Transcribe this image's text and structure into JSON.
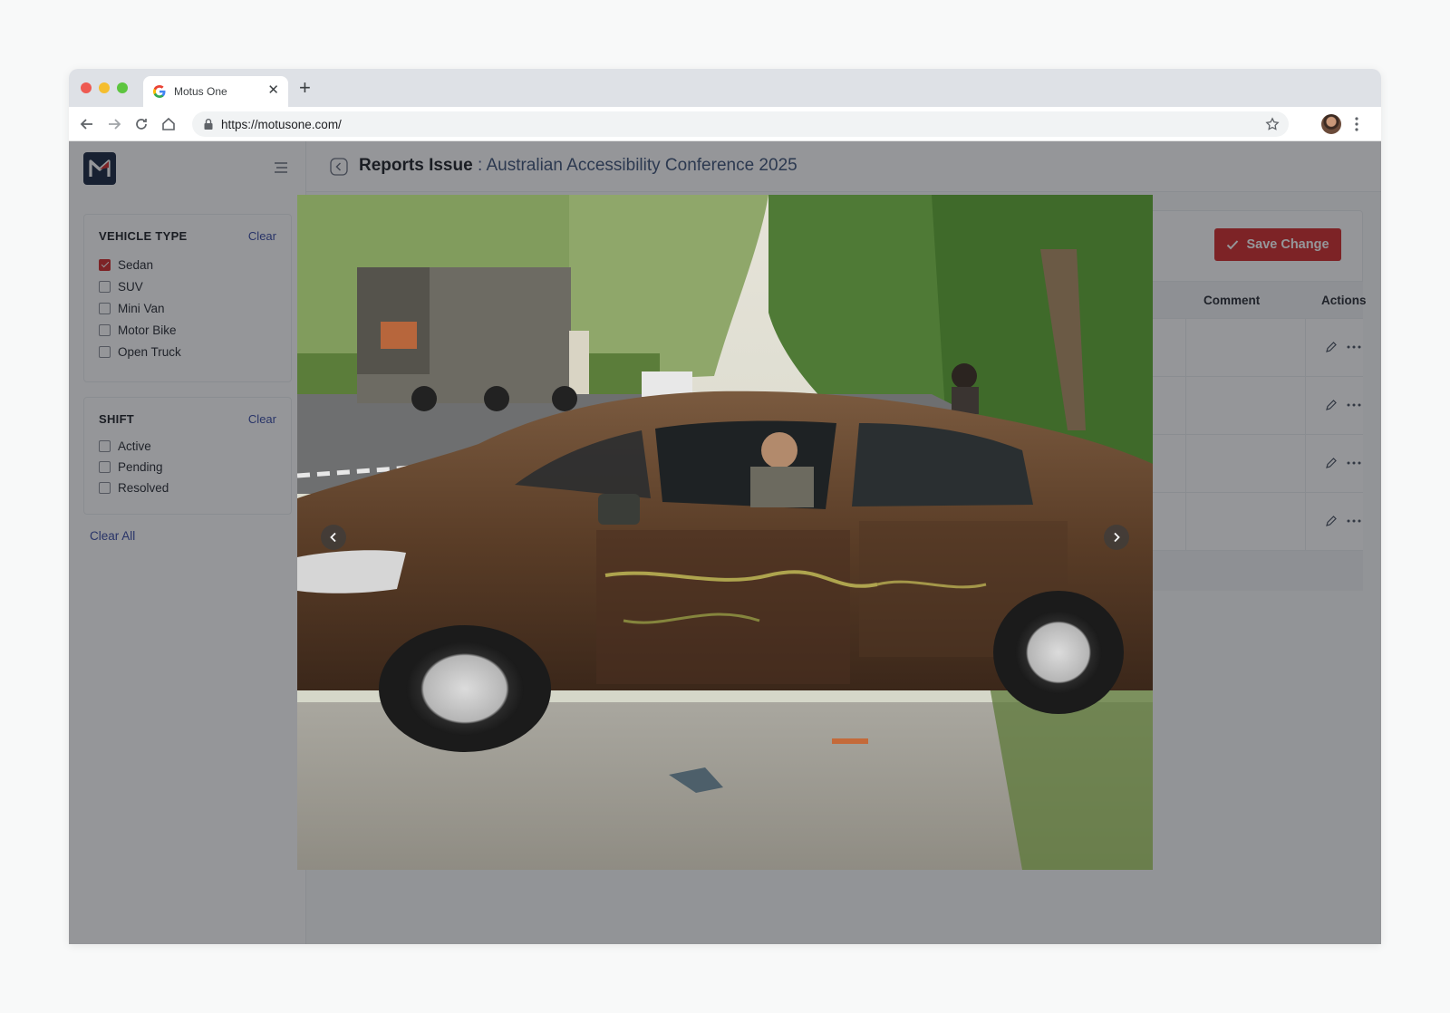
{
  "browser": {
    "tab_title": "Motus One",
    "url": "https://motusone.com/"
  },
  "sidebar": {
    "filters": [
      {
        "title": "VEHICLE TYPE",
        "clear_label": "Clear",
        "options": [
          {
            "label": "Sedan",
            "checked": true
          },
          {
            "label": "SUV",
            "checked": false
          },
          {
            "label": "Mini Van",
            "checked": false
          },
          {
            "label": "Motor Bike",
            "checked": false
          },
          {
            "label": "Open Truck",
            "checked": false
          }
        ]
      },
      {
        "title": "SHIFT",
        "clear_label": "Clear",
        "options": [
          {
            "label": "Active",
            "checked": false
          },
          {
            "label": "Pending",
            "checked": false
          },
          {
            "label": "Resolved",
            "checked": false
          }
        ]
      }
    ],
    "clear_all_label": "Clear All"
  },
  "header": {
    "title": "Reports Issue",
    "separator": ":",
    "event": "Australian Accessibility Conference 2025"
  },
  "toolbar": {
    "save_label": "Save Change"
  },
  "table": {
    "columns": [
      "Comment",
      "Actions"
    ],
    "row_count": 4
  },
  "colors": {
    "accent": "#d42e2e",
    "link": "#3b4ea6",
    "logo_bg": "#1d2b44"
  },
  "icons": [
    "back-arrow-icon",
    "forward-arrow-icon",
    "reload-icon",
    "home-icon",
    "lock-icon",
    "star-icon",
    "menu-icon",
    "chevron-left-icon",
    "check-icon",
    "pencil-icon",
    "more-horizontal-icon"
  ]
}
